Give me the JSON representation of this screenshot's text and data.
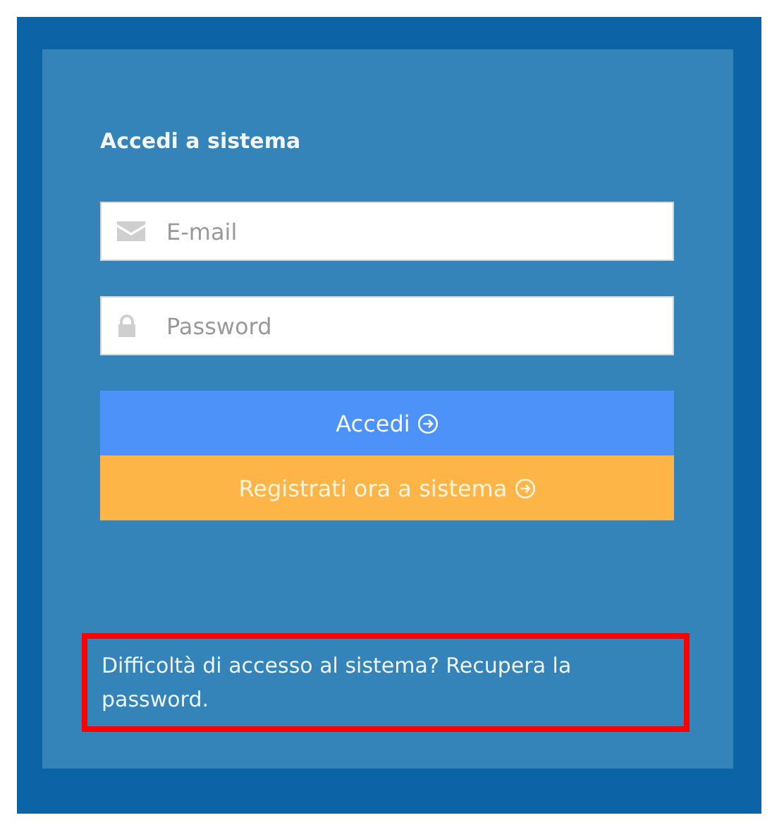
{
  "login": {
    "title": "Accedi a sistema",
    "fields": [
      {
        "kind": "email",
        "placeholder": "E-mail"
      },
      {
        "kind": "password",
        "placeholder": "Password"
      }
    ],
    "buttons": [
      {
        "kind": "primary",
        "label": "Accedi"
      },
      {
        "kind": "secondary",
        "label": "Registrati ora a sistema"
      }
    ],
    "help_text": "Difficoltà di accesso al sistema? Recupera la password.",
    "help_highlighted": true
  }
}
